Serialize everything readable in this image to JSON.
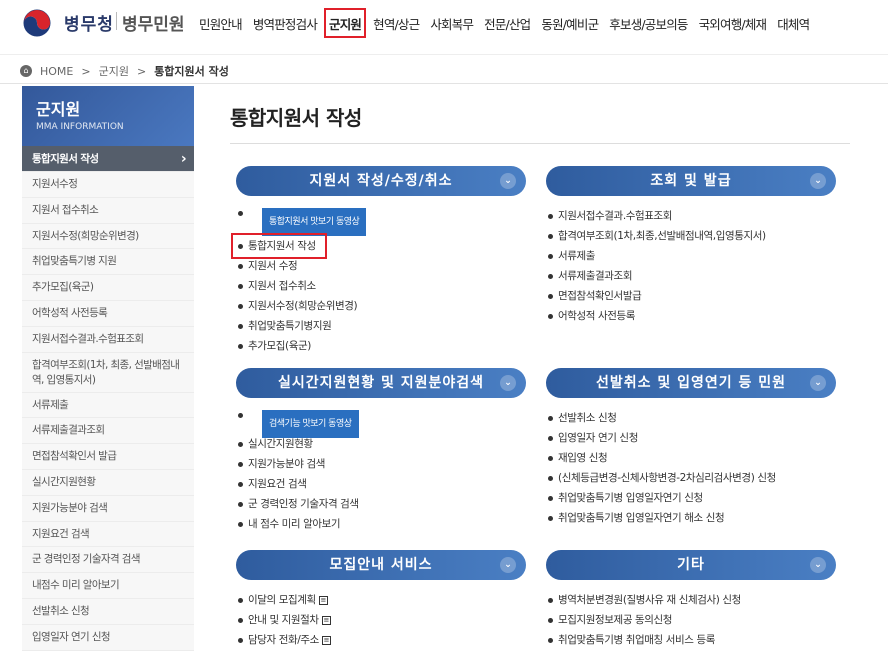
{
  "brand": {
    "name": "병무청",
    "sub": "병무민원"
  },
  "gnb": [
    "민원안내",
    "병역판정검사",
    "군지원",
    "현역/상근",
    "사회복무",
    "전문/산업",
    "동원/예비군",
    "후보생/공보의등",
    "국외여행/체재",
    "대체역"
  ],
  "breadcrumb": {
    "home": "HOME",
    "sep": ">",
    "mid": "군지원",
    "current": "통합지원서 작성"
  },
  "sidebar": {
    "title": "군지원",
    "subtitle": "MMA INFORMATION",
    "items": [
      "통합지원서 작성",
      "지원서수정",
      "지원서 접수취소",
      "지원서수정(희망순위변경)",
      "취업맞춤특기병 지원",
      "추가모집(육군)",
      "어학성적 사전등록",
      "지원서접수결과.수험표조회",
      "합격여부조회(1차, 최종, 선발배점내역, 입영통지서)",
      "서류제출",
      "서류제출결과조회",
      "면접참석확인서 발급",
      "실시간지원현황",
      "지원가능분야 검색",
      "지원요건 검색",
      "군 경력인정 기술자격 검색",
      "내점수 미리 알아보기",
      "선발취소 신청",
      "입영일자 연기 신청"
    ]
  },
  "main": {
    "title": "통합지원서 작성"
  },
  "boxes": {
    "b1": {
      "title": "지원서 작성/수정/취소",
      "video": "통합지원서 맛보기 동영상",
      "items": [
        "통합지원서 작성",
        "지원서 수정",
        "지원서 접수취소",
        "지원서수정(희망순위변경)",
        "취업맞춤특기병지원",
        "추가모집(육군)"
      ]
    },
    "b2": {
      "title": "조회 및 발급",
      "items": [
        "지원서접수결과.수험표조회",
        "합격여부조회(1차,최종,선발배점내역,입영통지서)",
        "서류제출",
        "서류제출결과조회",
        "면접참석확인서발급",
        "어학성적 사전등록"
      ]
    },
    "b3": {
      "title": "실시간지원현황 및 지원분야검색",
      "video": "검색기능 맛보기 동영상",
      "items": [
        "실시간지원현황",
        "지원가능분야 검색",
        "지원요건 검색",
        "군 경력인정 기술자격 검색",
        "내 점수 미리 알아보기"
      ]
    },
    "b4": {
      "title": "선발취소 및 입영연기 등 민원",
      "items": [
        "선발취소 신청",
        "입영일자 연기 신청",
        "재입영 신청",
        "(신체등급변경-신체사항변경-2차심리검사변경) 신청",
        "취업맞춤특기병 입영일자연기 신청",
        "취업맞춤특기병 입영일자연기 해소 신청"
      ]
    },
    "b5": {
      "title": "모집안내 서비스",
      "items": [
        "이달의 모집계획",
        "안내 및 지원절차",
        "담당자 전화/주소"
      ]
    },
    "b6": {
      "title": "기타",
      "items": [
        "병역처분변경원(질병사유 재 신체검사) 신청",
        "모집지원정보제공 동의신청",
        "취업맞춤특기병 취업매칭 서비스 등록"
      ]
    }
  },
  "colors": {
    "accent": "#2f5c9e",
    "highlight": "#e0202a"
  }
}
